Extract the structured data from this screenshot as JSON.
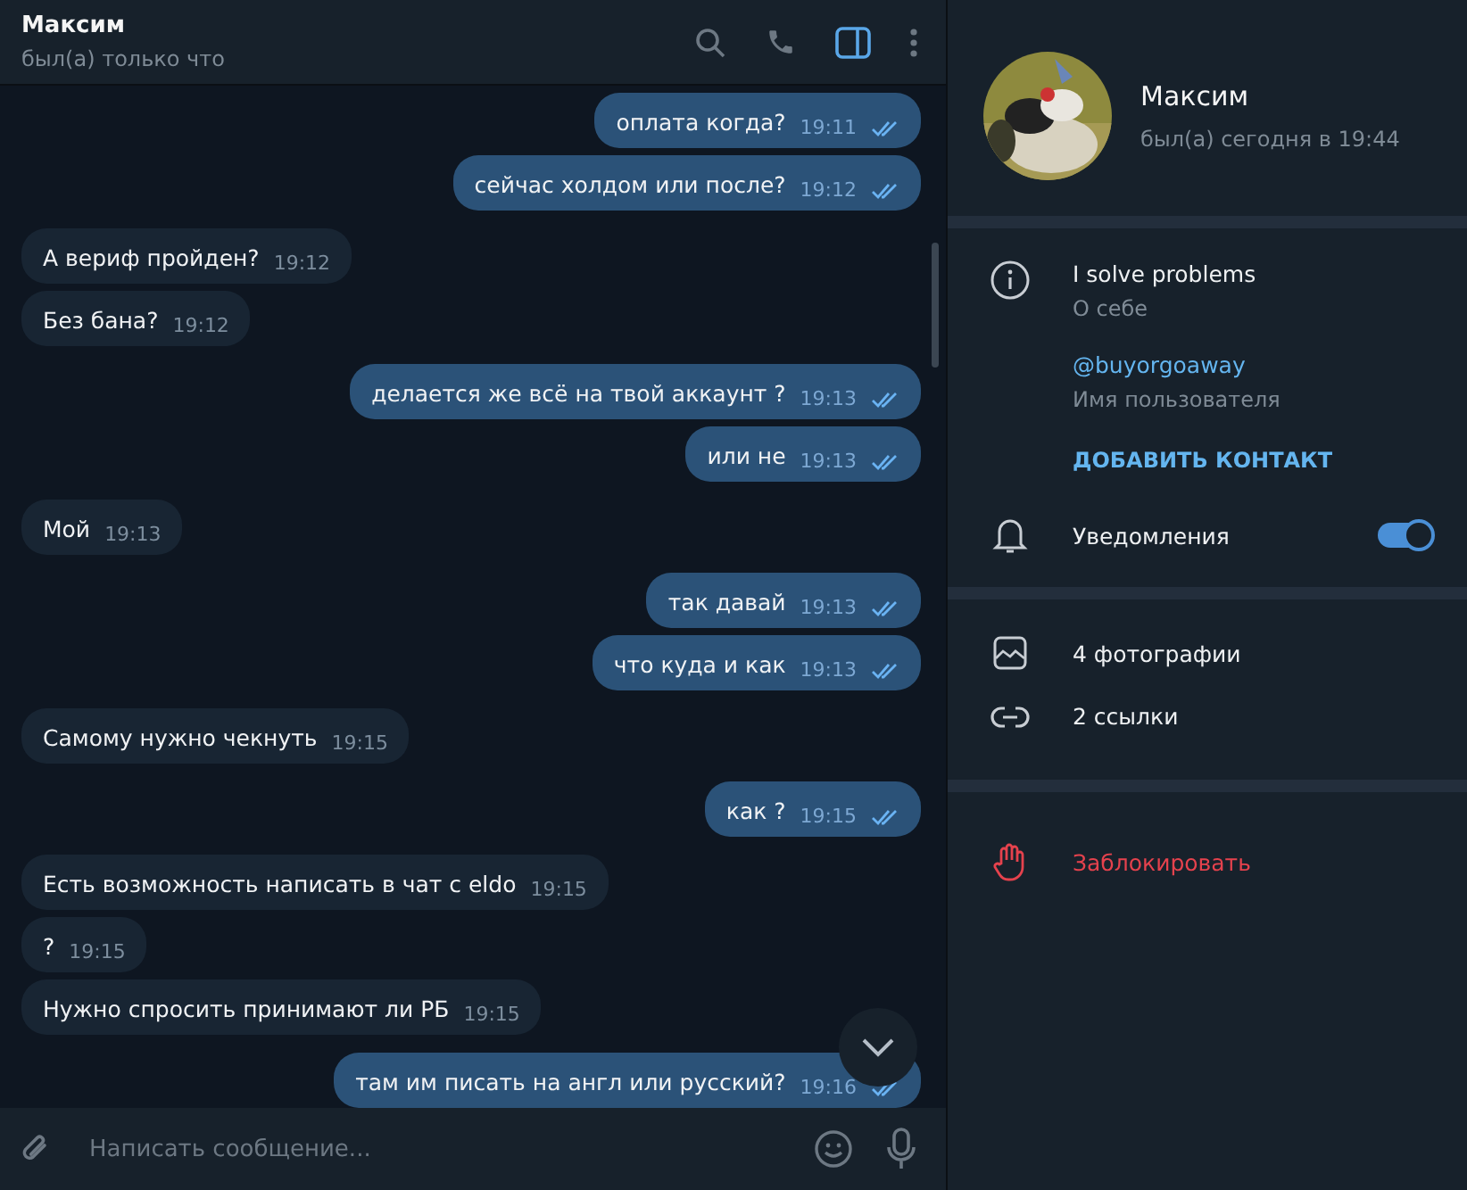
{
  "chat_header": {
    "name": "Максим",
    "status": "был(а) только что",
    "side_panel_open": true
  },
  "messages": [
    {
      "outgoing": true,
      "text": "оплата когда?",
      "time": "19:11",
      "read": true
    },
    {
      "outgoing": true,
      "text": "сейчас холдом или после?",
      "time": "19:12",
      "read": true
    },
    {
      "outgoing": false,
      "text": "А вериф пройден?",
      "time": "19:12"
    },
    {
      "outgoing": false,
      "text": "Без бана?",
      "time": "19:12"
    },
    {
      "outgoing": true,
      "text": "делается же всё на твой аккаунт ?",
      "time": "19:13",
      "read": true
    },
    {
      "outgoing": true,
      "text": "или не",
      "time": "19:13",
      "read": true
    },
    {
      "outgoing": false,
      "text": "Мой",
      "time": "19:13"
    },
    {
      "outgoing": true,
      "text": "так давай",
      "time": "19:13",
      "read": true
    },
    {
      "outgoing": true,
      "text": "что куда и как",
      "time": "19:13",
      "read": true
    },
    {
      "outgoing": false,
      "text": "Самому нужно чекнуть",
      "time": "19:15"
    },
    {
      "outgoing": true,
      "text": "как ?",
      "time": "19:15",
      "read": true
    },
    {
      "outgoing": false,
      "text": "Есть возможность написать в чат с eldo",
      "time": "19:15"
    },
    {
      "outgoing": false,
      "text": "?",
      "time": "19:15"
    },
    {
      "outgoing": false,
      "text": "Нужно спросить принимают ли РБ",
      "time": "19:15"
    },
    {
      "outgoing": true,
      "text": "там им писать на англ или русский?",
      "time": "19:16",
      "read": true
    }
  ],
  "composer": {
    "placeholder": "Написать сообщение..."
  },
  "profile": {
    "name": "Максим",
    "last_seen": "был(а) сегодня в 19:44",
    "bio": "I solve problems",
    "bio_label": "О себе",
    "username": "@buyorgoaway",
    "username_label": "Имя пользователя",
    "add_contact": "ДОБАВИТЬ КОНТАКТ",
    "notifications": {
      "label": "Уведомления",
      "on": true
    },
    "media": [
      {
        "kind": "photos",
        "label": "4 фотографии"
      },
      {
        "kind": "links",
        "label": "2 ссылки"
      }
    ],
    "block": "Заблокировать"
  }
}
